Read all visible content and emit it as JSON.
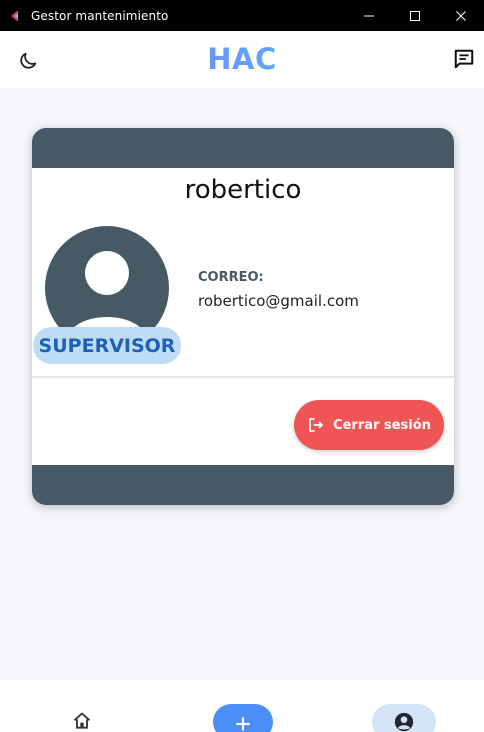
{
  "window": {
    "title": "Gestor mantenimiento",
    "controls": [
      "minimize-icon",
      "maximize-icon",
      "close-icon"
    ]
  },
  "header": {
    "brand": "HAC",
    "left_icon": "moon-icon",
    "right_icon": "chat-icon"
  },
  "profile": {
    "username": "robertico",
    "role": "SUPERVISOR",
    "email_label": "CORREO:",
    "email": "robertico@gmail.com",
    "avatar_icon": "user-avatar-icon"
  },
  "actions": {
    "logout_label": "Cerrar sesión",
    "logout_icon": "logout-icon"
  },
  "bottom_nav": {
    "items": [
      {
        "icon": "home-icon",
        "active": false
      },
      {
        "icon": "plus-icon",
        "active": false
      },
      {
        "icon": "account-icon",
        "active": true
      }
    ]
  },
  "colors": {
    "card_band": "#475964",
    "role_badge_bg": "#bfdcf6",
    "role_badge_text": "#1d61b6",
    "logout_bg": "#ef5555",
    "add_button_bg": "#4b8ef8",
    "active_nav_bg": "#d6e4f7",
    "brand_gradient": [
      "#8b5cf6",
      "#38bdf8"
    ]
  }
}
